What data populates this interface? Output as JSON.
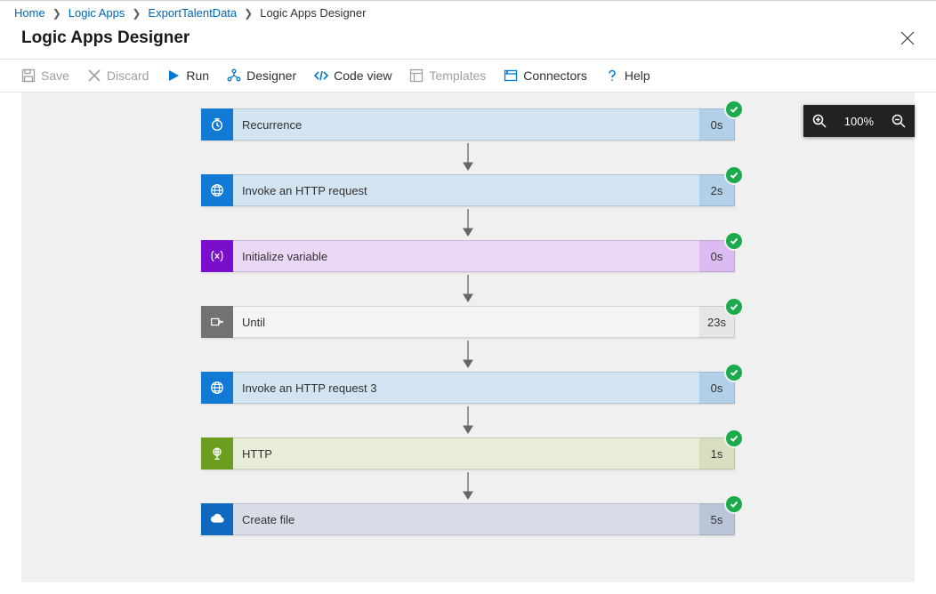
{
  "breadcrumb": {
    "home": "Home",
    "logic_apps": "Logic Apps",
    "export": "ExportTalentData",
    "current": "Logic Apps Designer"
  },
  "page_title": "Logic Apps Designer",
  "toolbar": {
    "save": "Save",
    "discard": "Discard",
    "run": "Run",
    "designer": "Designer",
    "code_view": "Code view",
    "templates": "Templates",
    "connectors": "Connectors",
    "help": "Help"
  },
  "zoom_label": "100%",
  "steps": [
    {
      "title": "Recurrence",
      "duration": "0s"
    },
    {
      "title": "Invoke an HTTP request",
      "duration": "2s"
    },
    {
      "title": "Initialize variable",
      "duration": "0s"
    },
    {
      "title": "Until",
      "duration": "23s"
    },
    {
      "title": "Invoke an HTTP request 3",
      "duration": "0s"
    },
    {
      "title": "HTTP",
      "duration": "1s"
    },
    {
      "title": "Create file",
      "duration": "5s"
    }
  ]
}
